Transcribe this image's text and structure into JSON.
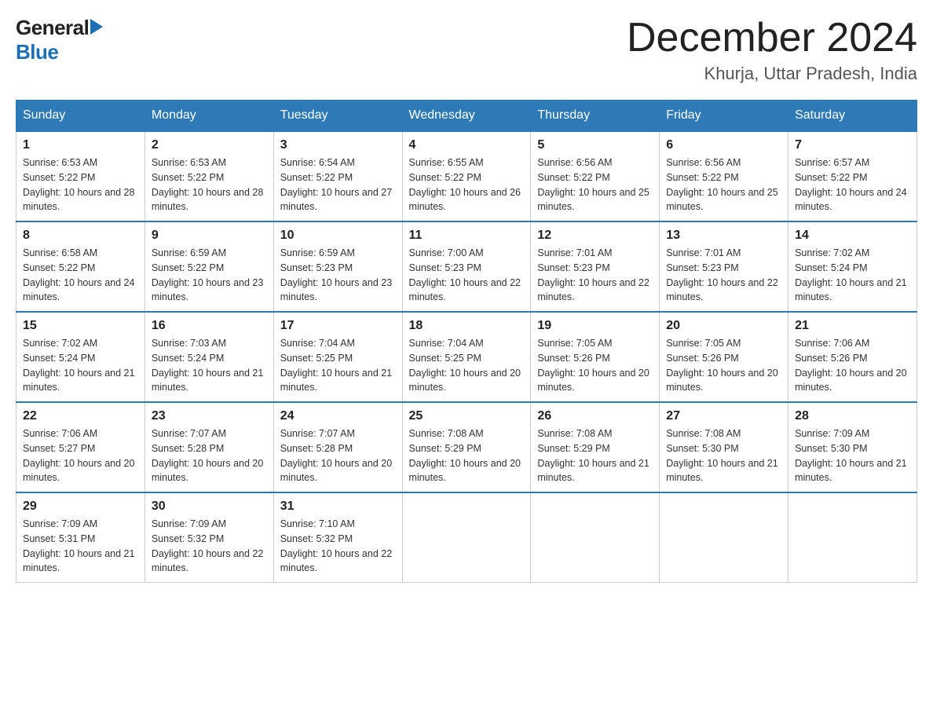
{
  "logo": {
    "general": "General",
    "blue": "Blue"
  },
  "title": "December 2024",
  "subtitle": "Khurja, Uttar Pradesh, India",
  "days_of_week": [
    "Sunday",
    "Monday",
    "Tuesday",
    "Wednesday",
    "Thursday",
    "Friday",
    "Saturday"
  ],
  "weeks": [
    [
      {
        "day": "1",
        "sunrise": "6:53 AM",
        "sunset": "5:22 PM",
        "daylight": "10 hours and 28 minutes."
      },
      {
        "day": "2",
        "sunrise": "6:53 AM",
        "sunset": "5:22 PM",
        "daylight": "10 hours and 28 minutes."
      },
      {
        "day": "3",
        "sunrise": "6:54 AM",
        "sunset": "5:22 PM",
        "daylight": "10 hours and 27 minutes."
      },
      {
        "day": "4",
        "sunrise": "6:55 AM",
        "sunset": "5:22 PM",
        "daylight": "10 hours and 26 minutes."
      },
      {
        "day": "5",
        "sunrise": "6:56 AM",
        "sunset": "5:22 PM",
        "daylight": "10 hours and 25 minutes."
      },
      {
        "day": "6",
        "sunrise": "6:56 AM",
        "sunset": "5:22 PM",
        "daylight": "10 hours and 25 minutes."
      },
      {
        "day": "7",
        "sunrise": "6:57 AM",
        "sunset": "5:22 PM",
        "daylight": "10 hours and 24 minutes."
      }
    ],
    [
      {
        "day": "8",
        "sunrise": "6:58 AM",
        "sunset": "5:22 PM",
        "daylight": "10 hours and 24 minutes."
      },
      {
        "day": "9",
        "sunrise": "6:59 AM",
        "sunset": "5:22 PM",
        "daylight": "10 hours and 23 minutes."
      },
      {
        "day": "10",
        "sunrise": "6:59 AM",
        "sunset": "5:23 PM",
        "daylight": "10 hours and 23 minutes."
      },
      {
        "day": "11",
        "sunrise": "7:00 AM",
        "sunset": "5:23 PM",
        "daylight": "10 hours and 22 minutes."
      },
      {
        "day": "12",
        "sunrise": "7:01 AM",
        "sunset": "5:23 PM",
        "daylight": "10 hours and 22 minutes."
      },
      {
        "day": "13",
        "sunrise": "7:01 AM",
        "sunset": "5:23 PM",
        "daylight": "10 hours and 22 minutes."
      },
      {
        "day": "14",
        "sunrise": "7:02 AM",
        "sunset": "5:24 PM",
        "daylight": "10 hours and 21 minutes."
      }
    ],
    [
      {
        "day": "15",
        "sunrise": "7:02 AM",
        "sunset": "5:24 PM",
        "daylight": "10 hours and 21 minutes."
      },
      {
        "day": "16",
        "sunrise": "7:03 AM",
        "sunset": "5:24 PM",
        "daylight": "10 hours and 21 minutes."
      },
      {
        "day": "17",
        "sunrise": "7:04 AM",
        "sunset": "5:25 PM",
        "daylight": "10 hours and 21 minutes."
      },
      {
        "day": "18",
        "sunrise": "7:04 AM",
        "sunset": "5:25 PM",
        "daylight": "10 hours and 20 minutes."
      },
      {
        "day": "19",
        "sunrise": "7:05 AM",
        "sunset": "5:26 PM",
        "daylight": "10 hours and 20 minutes."
      },
      {
        "day": "20",
        "sunrise": "7:05 AM",
        "sunset": "5:26 PM",
        "daylight": "10 hours and 20 minutes."
      },
      {
        "day": "21",
        "sunrise": "7:06 AM",
        "sunset": "5:26 PM",
        "daylight": "10 hours and 20 minutes."
      }
    ],
    [
      {
        "day": "22",
        "sunrise": "7:06 AM",
        "sunset": "5:27 PM",
        "daylight": "10 hours and 20 minutes."
      },
      {
        "day": "23",
        "sunrise": "7:07 AM",
        "sunset": "5:28 PM",
        "daylight": "10 hours and 20 minutes."
      },
      {
        "day": "24",
        "sunrise": "7:07 AM",
        "sunset": "5:28 PM",
        "daylight": "10 hours and 20 minutes."
      },
      {
        "day": "25",
        "sunrise": "7:08 AM",
        "sunset": "5:29 PM",
        "daylight": "10 hours and 20 minutes."
      },
      {
        "day": "26",
        "sunrise": "7:08 AM",
        "sunset": "5:29 PM",
        "daylight": "10 hours and 21 minutes."
      },
      {
        "day": "27",
        "sunrise": "7:08 AM",
        "sunset": "5:30 PM",
        "daylight": "10 hours and 21 minutes."
      },
      {
        "day": "28",
        "sunrise": "7:09 AM",
        "sunset": "5:30 PM",
        "daylight": "10 hours and 21 minutes."
      }
    ],
    [
      {
        "day": "29",
        "sunrise": "7:09 AM",
        "sunset": "5:31 PM",
        "daylight": "10 hours and 21 minutes."
      },
      {
        "day": "30",
        "sunrise": "7:09 AM",
        "sunset": "5:32 PM",
        "daylight": "10 hours and 22 minutes."
      },
      {
        "day": "31",
        "sunrise": "7:10 AM",
        "sunset": "5:32 PM",
        "daylight": "10 hours and 22 minutes."
      },
      null,
      null,
      null,
      null
    ]
  ]
}
